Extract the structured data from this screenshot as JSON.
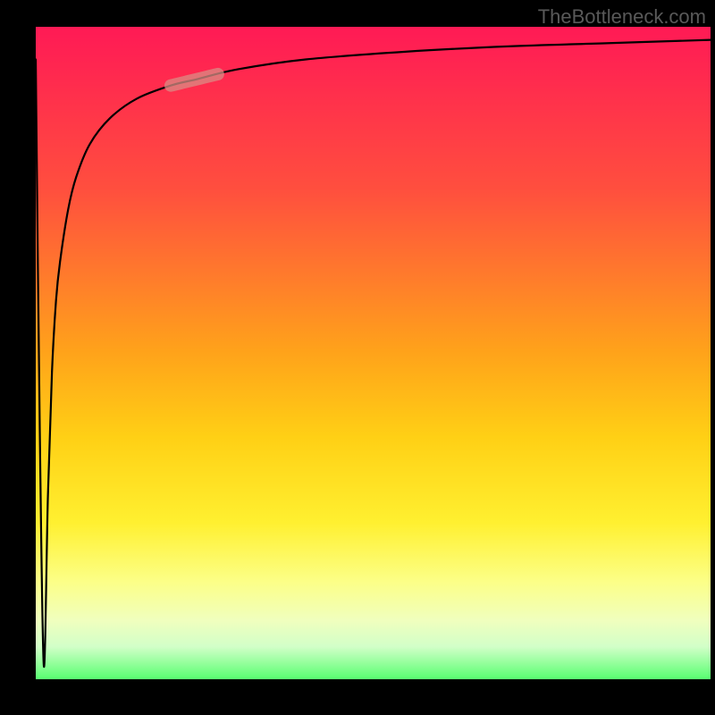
{
  "attribution": "TheBottleneck.com",
  "colors": {
    "page_bg": "#000000",
    "attribution_text": "#595959",
    "curve_stroke": "#000000",
    "highlight_stroke": "#d98c84",
    "gradient_top": "#ff1a55",
    "gradient_bottom": "#57ff70"
  },
  "chart_data": {
    "type": "line",
    "title": "",
    "xlabel": "",
    "ylabel": "",
    "xlim": [
      0,
      100
    ],
    "ylim": [
      0,
      100
    ],
    "grid": false,
    "series": [
      {
        "name": "bottleneck-curve",
        "x": [
          0,
          0.6,
          1.2,
          1.8,
          2.4,
          3,
          3.6,
          4.8,
          6,
          8,
          11,
          15,
          20,
          24,
          30,
          40,
          55,
          70,
          85,
          100
        ],
        "y": [
          95,
          38,
          2,
          28,
          47,
          58,
          64,
          72,
          77,
          82,
          86,
          89,
          91,
          92,
          93.5,
          95,
          96.2,
          97,
          97.5,
          98
        ]
      }
    ],
    "highlight_segment": {
      "x_start": 20,
      "x_end": 27,
      "note": "thick faded segment on curve"
    }
  }
}
